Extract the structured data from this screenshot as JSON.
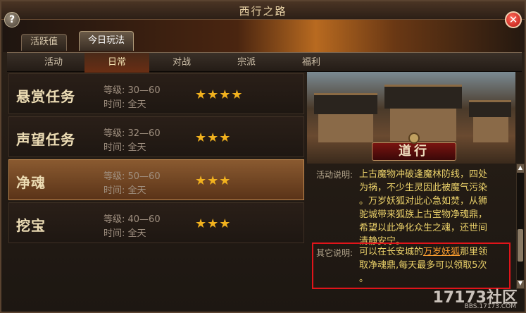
{
  "window": {
    "title": "西行之路"
  },
  "main_tabs": [
    {
      "label": "活跃值"
    },
    {
      "label": "今日玩法"
    }
  ],
  "sub_tabs": [
    {
      "label": "活动"
    },
    {
      "label": "日常"
    },
    {
      "label": "对战"
    },
    {
      "label": "宗派"
    },
    {
      "label": "福利"
    }
  ],
  "tasks": [
    {
      "name": "悬赏任务",
      "level": "等级: 30—60",
      "time": "时间: 全天",
      "stars": "★★★★",
      "star_count": 4
    },
    {
      "name": "声望任务",
      "level": "等级: 32—60",
      "time": "时间: 全天",
      "stars": "★★★",
      "star_count": 3
    },
    {
      "name": "净魂",
      "level": "等级: 50—60",
      "time": "时间: 全天",
      "stars": "★★★",
      "star_count": 3
    },
    {
      "name": "挖宝",
      "level": "等级: 40—60",
      "time": "时间: 全天",
      "stars": "★★★",
      "star_count": 3
    }
  ],
  "detail": {
    "emblem": "道行",
    "activity_label": "活动说明:",
    "activity_lines": [
      "上古魔物冲破逢魔林防线，四处",
      "为祸，不少生灵因此被魔气污染",
      "。万岁妖狐对此心急如焚，从狮",
      "驼城带来狐族上古宝物净魂鼎，",
      "希望以此净化众生之魂，还世间",
      "清静安宁。"
    ],
    "other_label": "其它说明:",
    "other_line1_pre": "可以在长安城的",
    "other_line1_link": "万岁妖狐",
    "other_line1_post": "那里领",
    "other_line2": "取净魂鼎,每天最多可以领取5次",
    "other_line3": "。"
  },
  "watermark": {
    "logo": "17173社区",
    "url": "BBS.17173.COM"
  },
  "colors": {
    "accent_red": "#e0141a",
    "star": "#f2b21e",
    "text_gold": "#ecd26a"
  }
}
